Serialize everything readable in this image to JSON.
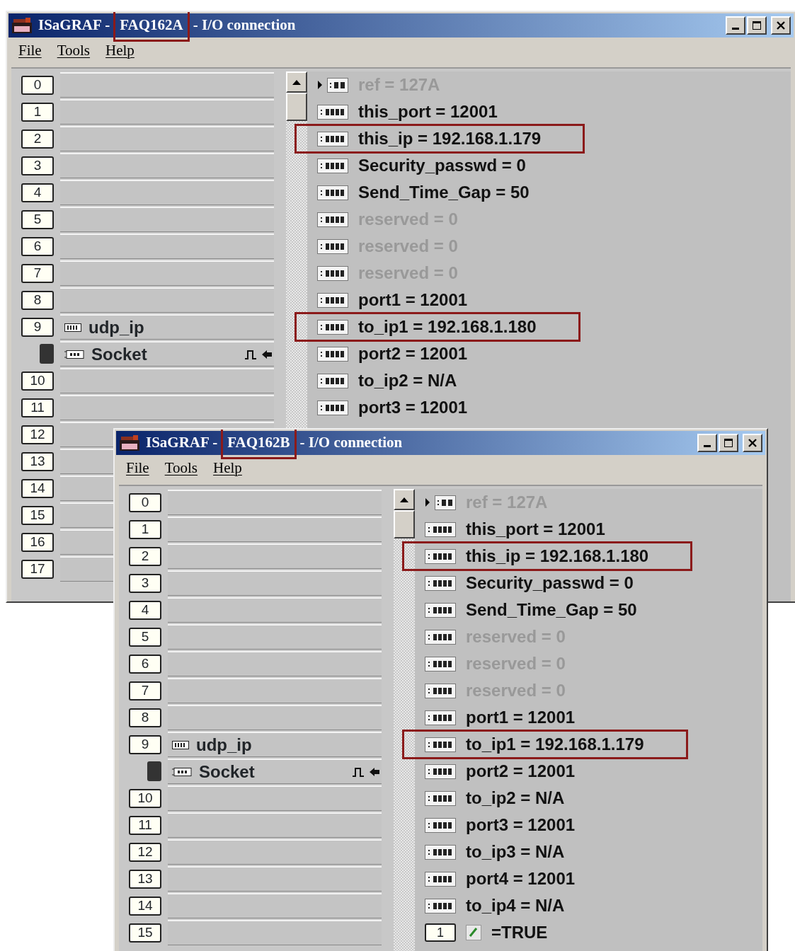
{
  "windows": [
    {
      "title": {
        "app": "ISaGRAF -",
        "project": "FAQ162A",
        "project_highlighted": true,
        "caption": "- I/O connection"
      },
      "menu": [
        "File",
        "Tools",
        "Help"
      ],
      "slots": [
        {
          "number": "0"
        },
        {
          "number": "1"
        },
        {
          "number": "2"
        },
        {
          "number": "3"
        },
        {
          "number": "4"
        },
        {
          "number": "5"
        },
        {
          "number": "6"
        },
        {
          "number": "7"
        },
        {
          "number": "8"
        },
        {
          "number": "9",
          "board": "udp_ip",
          "devices": [
            {
              "name": "Socket",
              "selected": true
            }
          ]
        },
        {
          "number": "10"
        },
        {
          "number": "11"
        },
        {
          "number": "12"
        },
        {
          "number": "13"
        },
        {
          "number": "14"
        },
        {
          "number": "15"
        },
        {
          "number": "16"
        },
        {
          "number": "17"
        }
      ],
      "parameters": [
        {
          "kind": "ref",
          "text": "ref = 127A",
          "greyed": true,
          "highlighted": false
        },
        {
          "kind": "register",
          "text": "this_port = 12001",
          "greyed": false,
          "highlighted": false
        },
        {
          "kind": "register",
          "text": "this_ip = 192.168.1.179",
          "greyed": false,
          "highlighted": true
        },
        {
          "kind": "register",
          "text": "Security_passwd = 0",
          "greyed": false,
          "highlighted": false
        },
        {
          "kind": "register",
          "text": "Send_Time_Gap = 50",
          "greyed": false,
          "highlighted": false
        },
        {
          "kind": "register",
          "text": "reserved = 0",
          "greyed": true,
          "highlighted": false
        },
        {
          "kind": "register",
          "text": "reserved = 0",
          "greyed": true,
          "highlighted": false
        },
        {
          "kind": "register",
          "text": "reserved = 0",
          "greyed": true,
          "highlighted": false
        },
        {
          "kind": "register",
          "text": "port1 = 12001",
          "greyed": false,
          "highlighted": false
        },
        {
          "kind": "register",
          "text": "to_ip1 = 192.168.1.180",
          "greyed": false,
          "highlighted": true
        },
        {
          "kind": "register",
          "text": "port2 = 12001",
          "greyed": false,
          "highlighted": false
        },
        {
          "kind": "register",
          "text": "to_ip2 = N/A",
          "greyed": false,
          "highlighted": false
        },
        {
          "kind": "register",
          "text": "port3 = 12001",
          "greyed": false,
          "highlighted": false
        }
      ]
    },
    {
      "title": {
        "app": "ISaGRAF -",
        "project": "FAQ162B",
        "project_highlighted": true,
        "caption": "- I/O connection"
      },
      "menu": [
        "File",
        "Tools",
        "Help"
      ],
      "slots": [
        {
          "number": "0"
        },
        {
          "number": "1"
        },
        {
          "number": "2"
        },
        {
          "number": "3"
        },
        {
          "number": "4"
        },
        {
          "number": "5"
        },
        {
          "number": "6"
        },
        {
          "number": "7"
        },
        {
          "number": "8"
        },
        {
          "number": "9",
          "board": "udp_ip",
          "devices": [
            {
              "name": "Socket",
              "selected": true
            }
          ]
        },
        {
          "number": "10"
        },
        {
          "number": "11"
        },
        {
          "number": "12"
        },
        {
          "number": "13"
        },
        {
          "number": "14"
        },
        {
          "number": "15"
        }
      ],
      "parameters": [
        {
          "kind": "ref",
          "text": "ref = 127A",
          "greyed": true,
          "highlighted": false
        },
        {
          "kind": "register",
          "text": "this_port = 12001",
          "greyed": false,
          "highlighted": false
        },
        {
          "kind": "register",
          "text": "this_ip = 192.168.1.180",
          "greyed": false,
          "highlighted": true
        },
        {
          "kind": "register",
          "text": "Security_passwd = 0",
          "greyed": false,
          "highlighted": false
        },
        {
          "kind": "register",
          "text": "Send_Time_Gap = 50",
          "greyed": false,
          "highlighted": false
        },
        {
          "kind": "register",
          "text": "reserved = 0",
          "greyed": true,
          "highlighted": false
        },
        {
          "kind": "register",
          "text": "reserved = 0",
          "greyed": true,
          "highlighted": false
        },
        {
          "kind": "register",
          "text": "reserved = 0",
          "greyed": true,
          "highlighted": false
        },
        {
          "kind": "register",
          "text": "port1 = 12001",
          "greyed": false,
          "highlighted": false
        },
        {
          "kind": "register",
          "text": "to_ip1 = 192.168.1.179",
          "greyed": false,
          "highlighted": true
        },
        {
          "kind": "register",
          "text": "port2 = 12001",
          "greyed": false,
          "highlighted": false
        },
        {
          "kind": "register",
          "text": "to_ip2 = N/A",
          "greyed": false,
          "highlighted": false
        },
        {
          "kind": "register",
          "text": "port3 = 12001",
          "greyed": false,
          "highlighted": false
        },
        {
          "kind": "register",
          "text": "to_ip3 = N/A",
          "greyed": false,
          "highlighted": false
        },
        {
          "kind": "register",
          "text": "port4 = 12001",
          "greyed": false,
          "highlighted": false
        },
        {
          "kind": "register",
          "text": "to_ip4 = N/A",
          "greyed": false,
          "highlighted": false
        },
        {
          "kind": "boolean",
          "index": "1",
          "text": "=TRUE",
          "checked": true,
          "greyed": false,
          "highlighted": false
        }
      ]
    }
  ]
}
